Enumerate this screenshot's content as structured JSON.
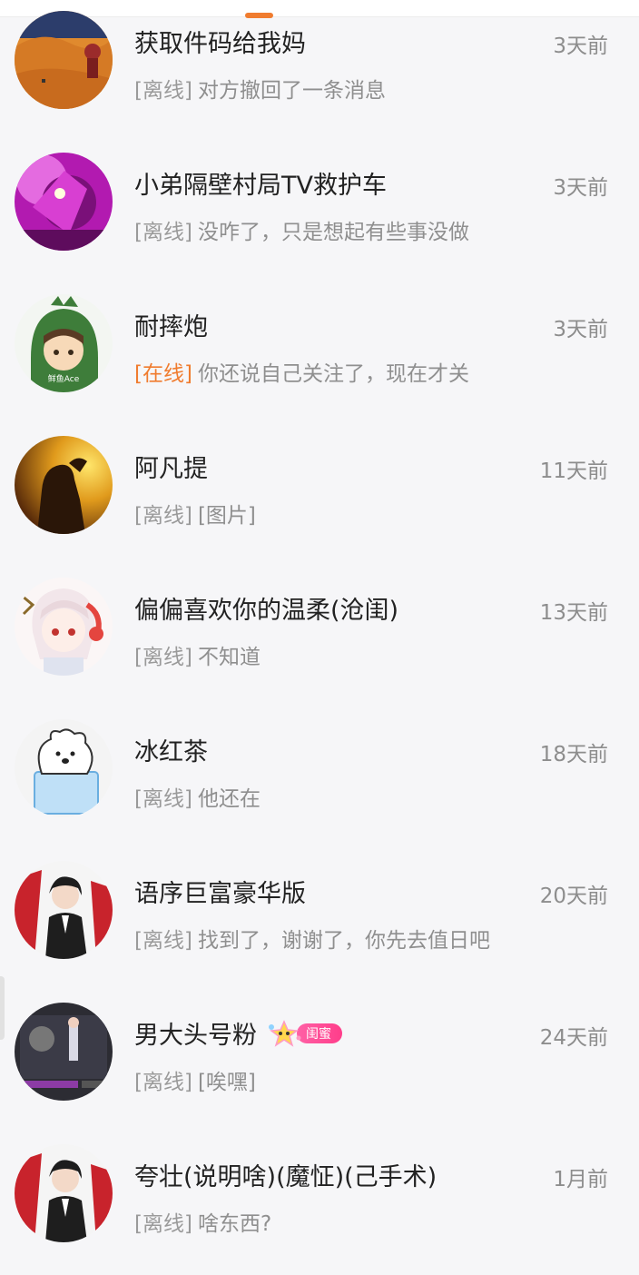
{
  "chats": [
    {
      "name": "获取件码给我妈",
      "time": "3天前",
      "status": "[离线]",
      "online": false,
      "message": "对方撤回了一条消息",
      "avatar": "desert-avatar"
    },
    {
      "name": "小弟隔壁村局TV救护车",
      "time": "3天前",
      "status": "[离线]",
      "online": false,
      "message": "没咋了，只是想起有些事没做",
      "avatar": "purple-avatar"
    },
    {
      "name": "耐摔炮",
      "time": "3天前",
      "status": "[在线]",
      "online": true,
      "message": "你还说自己关注了，现在才关",
      "avatar": "dino-hood-avatar"
    },
    {
      "name": "阿凡提",
      "time": "11天前",
      "status": "[离线]",
      "online": false,
      "message": "[图片]",
      "avatar": "sunset-avatar"
    },
    {
      "name": "偏偏喜欢你的温柔(沧闺)",
      "time": "13天前",
      "status": "[离线]",
      "online": false,
      "message": "不知道",
      "avatar": "anime-girl-avatar"
    },
    {
      "name": "冰红茶",
      "time": "18天前",
      "status": "[离线]",
      "online": false,
      "message": "他还在",
      "avatar": "bear-ice-avatar"
    },
    {
      "name": "语序巨富豪华版",
      "time": "20天前",
      "status": "[离线]",
      "online": false,
      "message": "找到了，谢谢了，你先去值日吧",
      "avatar": "suit-man-avatar"
    },
    {
      "name": "男大头号粉",
      "time": "24天前",
      "status": "[离线]",
      "online": false,
      "message": "[唉嘿]",
      "avatar": "screen-avatar",
      "badge": "闺蜜"
    },
    {
      "name": "夸壮(说明啥)(魔怔)(己手术)",
      "time": "1月前",
      "status": "[离线]",
      "online": false,
      "message": "啥东西?",
      "avatar": "suit-man-avatar"
    }
  ],
  "colors": {
    "accent": "#f07c2f",
    "badge": "#ff4d94"
  }
}
